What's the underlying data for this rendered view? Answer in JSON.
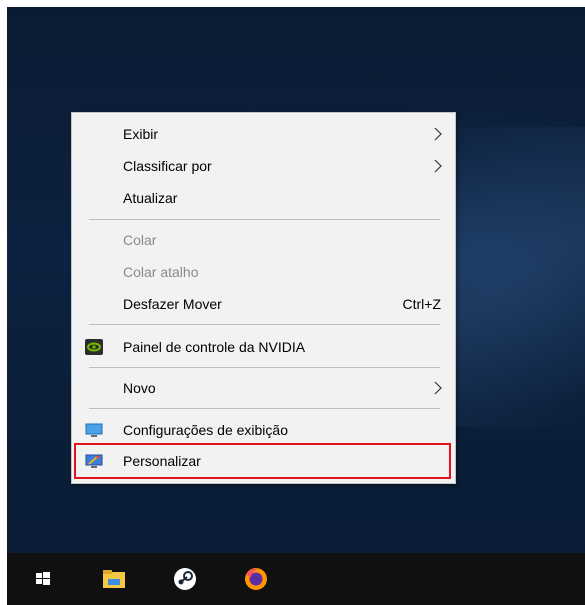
{
  "context_menu": {
    "items": [
      {
        "label": "Exibir",
        "has_submenu": true
      },
      {
        "label": "Classificar por",
        "has_submenu": true
      },
      {
        "label": "Atualizar"
      },
      {
        "label": "Colar",
        "disabled": true
      },
      {
        "label": "Colar atalho",
        "disabled": true
      },
      {
        "label": "Desfazer Mover",
        "accelerator": "Ctrl+Z"
      },
      {
        "label": "Painel de controle da NVIDIA",
        "icon": "nvidia-icon"
      },
      {
        "label": "Novo",
        "has_submenu": true
      },
      {
        "label": "Configurações de exibição",
        "icon": "display-settings-icon"
      },
      {
        "label": "Personalizar",
        "icon": "personalize-icon",
        "highlighted": true
      }
    ]
  },
  "taskbar": {
    "icons": [
      "windows-start-icon",
      "file-explorer-icon",
      "steam-icon",
      "firefox-icon"
    ]
  },
  "colors": {
    "menu_background": "#f2f2f2",
    "highlight_border": "#e3121b",
    "taskbar": "#101010",
    "desktop": "#0c2240"
  }
}
